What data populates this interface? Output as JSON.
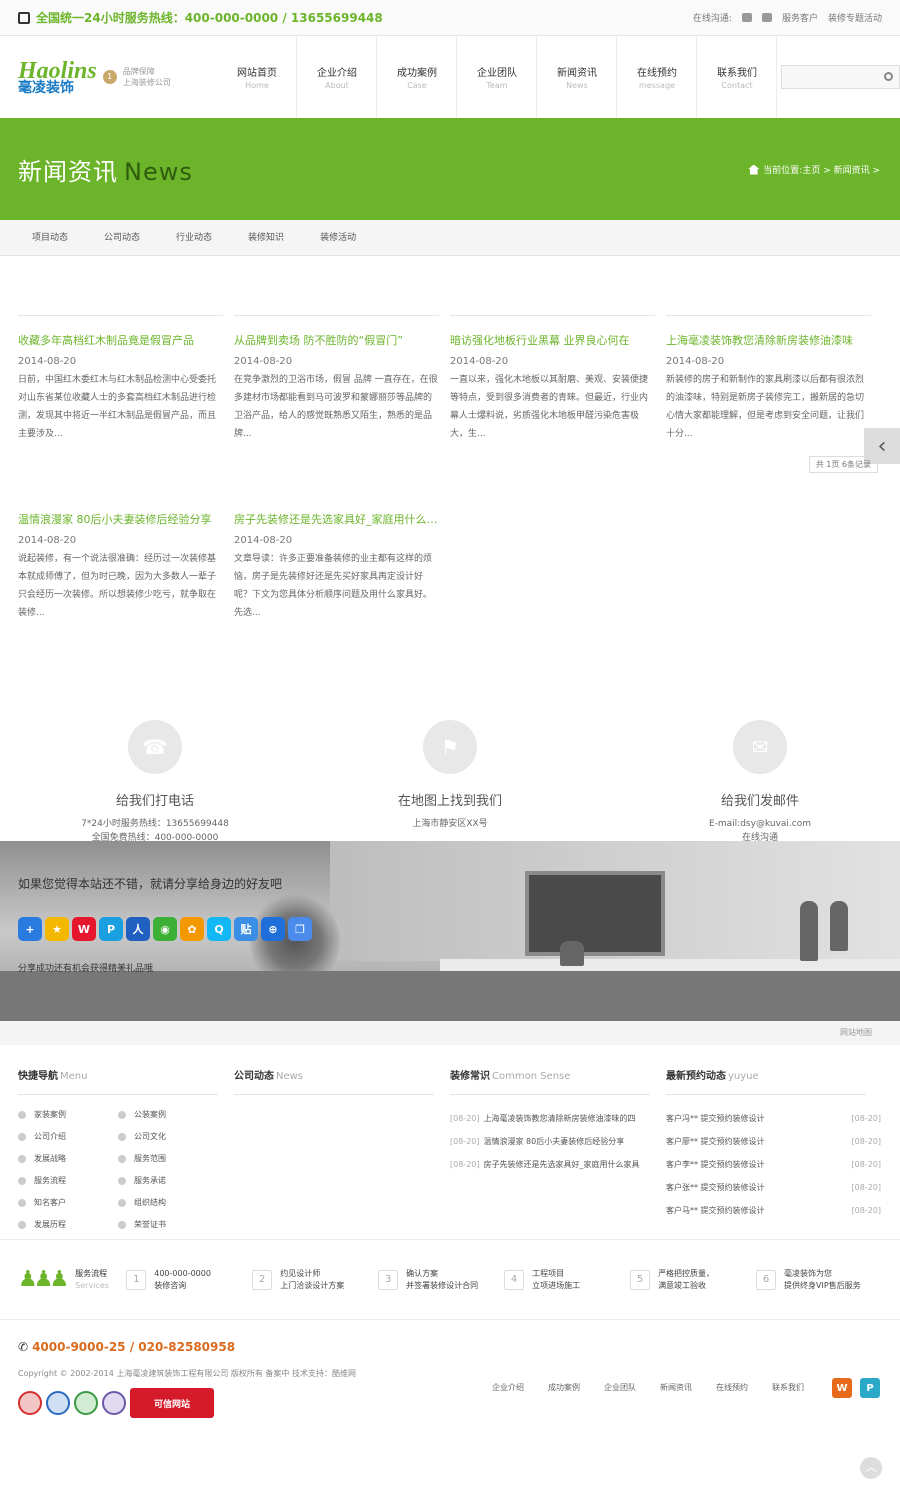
{
  "topbar": {
    "hotline": "全国统一24小时服务热线：400-000-0000 / 13655699448",
    "online": "在线沟通:",
    "service": "服务客户",
    "activity": "装修专题活动"
  },
  "logo": {
    "en": "Haolins",
    "cn": "毫凌装饰",
    "badge": "1",
    "slogan1": "品牌保障",
    "slogan2": "上海装修公司"
  },
  "nav": [
    {
      "t": "网站首页",
      "e": "Home"
    },
    {
      "t": "企业介绍",
      "e": "About"
    },
    {
      "t": "成功案例",
      "e": "Case"
    },
    {
      "t": "企业团队",
      "e": "Team"
    },
    {
      "t": "新闻资讯",
      "e": "News"
    },
    {
      "t": "在线预约",
      "e": "message"
    },
    {
      "t": "联系我们",
      "e": "Contact"
    }
  ],
  "banner": {
    "title_cn": "新闻资讯",
    "title_en": "News",
    "breadcrumb": "当前位置:主页 > 新闻资讯 >"
  },
  "tabs": [
    "项目动态",
    "公司动态",
    "行业动态",
    "装修知识",
    "装修活动"
  ],
  "news": [
    {
      "title": "收藏多年高档红木制品竟是假冒产品",
      "date": "2014-08-20",
      "summary": "日前，中国红木委红木与红木制品检测中心受委托对山东省某位收藏人士的多套高档红木制品进行检测，发现其中将近一半红木制品是假冒产品，而且主要涉及..."
    },
    {
      "title": "从品牌到卖场 防不胜防的“假冒门”",
      "date": "2014-08-20",
      "summary": "在竞争激烈的卫浴市场，假冒 品牌 一直存在，在很多建材市场都能看到马可波罗和蒙娜丽莎等品牌的卫浴产品，给人的感觉既熟悉又陌生，熟悉的是品牌..."
    },
    {
      "title": "暗访强化地板行业黑幕 业界良心何在",
      "date": "2014-08-20",
      "summary": "一直以来，强化木地板以其耐磨、美观、安装便捷等特点，受到很多消费者的青睐。但最近，行业内幕人士爆料说，劣质强化木地板甲醛污染危害极大，生..."
    },
    {
      "title": "上海毫凌装饰教您清除新房装修油漆味",
      "date": "2014-08-20",
      "summary": "新装修的房子和新制作的家具刷漆以后都有很浓烈的油漆味，特别是新房子装修完工，搬新居的急切心情大家都能理解，但是考虑到安全问题，让我们十分..."
    },
    {
      "title": "温情浪漫家 80后小夫妻装修后经验分享",
      "date": "2014-08-20",
      "summary": "说起装修，有一个说法很准确：经历过一次装修基本就成师傅了，但为时已晚，因为大多数人一辈子只会经历一次装修。所以想装修少吃亏，就争取在装修..."
    },
    {
      "title": "房子先装修还是先选家具好_家庭用什么家具",
      "date": "2014-08-20",
      "summary": "文章导读：许多正要准备装修的业主都有这样的烦恼，房子是先装修好还是先买好家具再定设计好呢？下文为您具体分析顺序问题及用什么家具好。 先选..."
    }
  ],
  "pager": "共 1页 6条记录",
  "contacts": [
    {
      "head": "给我们打电话",
      "line1": "7*24小时服务热线：13655699448",
      "line2": "全国免费热线：400-000-0000"
    },
    {
      "head": "在地图上找到我们",
      "line1": "上海市静安区XX号",
      "line2": ""
    },
    {
      "head": "给我们发邮件",
      "line1": "E-mail:dsy@kuvai.com",
      "line2": "在线沟通"
    }
  ],
  "share": {
    "text": "如果您觉得本站还不错，就请分享给身边的好友吧",
    "note": "分享成功还有机会获得精美礼品哦"
  },
  "sitemap": "网站地图",
  "footer": {
    "quick_title": "快捷导航",
    "quick_en": "Menu",
    "quick": [
      "家装案例",
      "公装案例",
      "公司介绍",
      "公司文化",
      "发展战略",
      "服务范围",
      "服务流程",
      "服务承诺",
      "知名客户",
      "组织结构",
      "发展历程",
      "荣誉证书"
    ],
    "company_title": "公司动态",
    "company_en": "News",
    "sense_title": "装修常识",
    "sense_en": "Common Sense",
    "sense": [
      {
        "d": "[08-20]",
        "t": "上海毫凌装饰教您清除新房装修油漆味的四"
      },
      {
        "d": "[08-20]",
        "t": "温情浪漫家 80后小夫妻装修后经验分享"
      },
      {
        "d": "[08-20]",
        "t": "房子先装修还是先选家具好_家庭用什么家具"
      }
    ],
    "order_title": "最新预约动态",
    "order_en": "yuyue",
    "orders": [
      {
        "t": "客户冯** 提交预约装修设计",
        "d": "[08-20]"
      },
      {
        "t": "客户廖** 提交预约装修设计",
        "d": "[08-20]"
      },
      {
        "t": "客户李** 提交预约装修设计",
        "d": "[08-20]"
      },
      {
        "t": "客户张** 提交预约装修设计",
        "d": "[08-20]"
      },
      {
        "t": "客户马** 提交预约装修设计",
        "d": "[08-20]"
      }
    ]
  },
  "process": {
    "title": "服务流程",
    "en": "Services",
    "steps": [
      {
        "n": "1",
        "a": "400-000-0000",
        "b": "装修咨询"
      },
      {
        "n": "2",
        "a": "约见设计师",
        "b": "上门洽谈设计方案"
      },
      {
        "n": "3",
        "a": "确认方案",
        "b": "并签署装修设计合同"
      },
      {
        "n": "4",
        "a": "工程项目",
        "b": "立项进场施工"
      },
      {
        "n": "5",
        "a": "严格把控质量，",
        "b": "满意竣工验收"
      },
      {
        "n": "6",
        "a": "毫凌装饰为您",
        "b": "提供终身VIP售后服务"
      }
    ]
  },
  "bottom": {
    "tel": "4000-9000-25 / 020-82580958",
    "copyright": "Copyright © 2002-2014 上海毫凌建筑装饰工程有限公司 版权所有 备案中 技术支持：酷维网",
    "trust": "可信网站",
    "links": [
      "企业介绍",
      "成功案例",
      "企业团队",
      "新闻资讯",
      "在线预约",
      "联系我们"
    ]
  },
  "colors": {
    "brand": "#6cb52b",
    "accent": "#d96a1e"
  }
}
